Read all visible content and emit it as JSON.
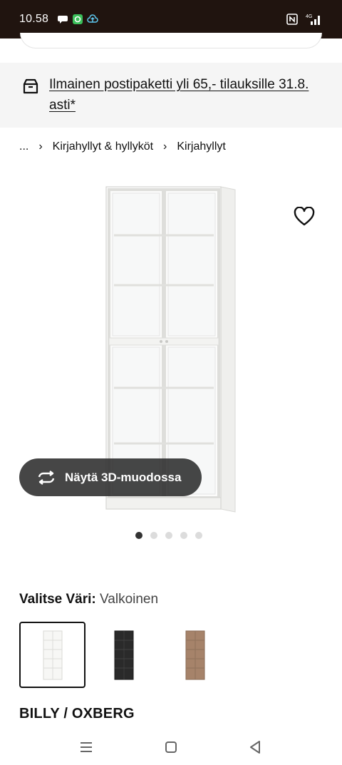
{
  "status_bar": {
    "time": "10.58",
    "network": "4G"
  },
  "promo": {
    "text": "Ilmainen postipaketti yli 65,- tilauksille 31.8. asti*",
    "icon": "delivery-box-icon"
  },
  "breadcrumb": {
    "items": [
      "...",
      "Kirjahyllyt & hyllyköt",
      "Kirjahyllyt"
    ],
    "separator": "›"
  },
  "product_image": {
    "description_icon": "bookcase-glass-doors-image"
  },
  "view_3d": {
    "label": "Näytä 3D-muodossa"
  },
  "carousel": {
    "total": 5,
    "active_index": 0
  },
  "color_selector": {
    "title": "Valitse Väri:",
    "selected_value": "Valkoinen",
    "options": [
      {
        "name": "white",
        "color": "#f4f4f2",
        "selected": true
      },
      {
        "name": "black-brown",
        "color": "#2a2a2a",
        "selected": false
      },
      {
        "name": "oak-effect",
        "color": "#a6836a",
        "selected": false
      }
    ]
  },
  "product": {
    "name": "BILLY / OXBERG"
  },
  "colors": {
    "status_bar_bg": "#20140f",
    "promo_bg": "#f5f5f5",
    "pill_bg": "#2c2c2c"
  }
}
